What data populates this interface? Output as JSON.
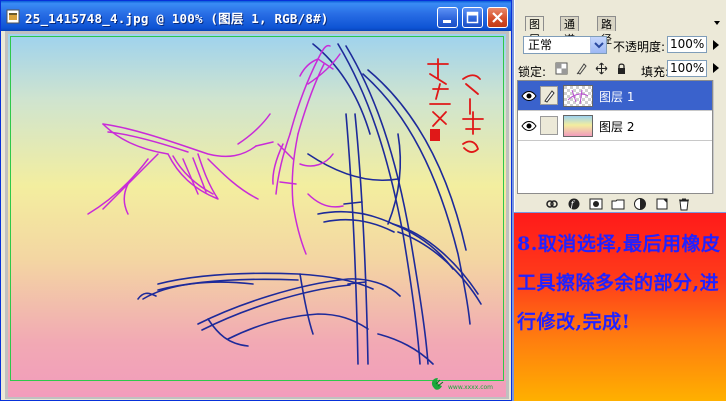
{
  "document": {
    "title": "25_1415748_4.jpg @ 100% (图层 1, RGB/8#)",
    "watermark_text": "www.xxxx.com"
  },
  "layers_panel": {
    "tabs": [
      {
        "label": "图层",
        "active": true
      },
      {
        "label": "通道",
        "active": false
      },
      {
        "label": "路径",
        "active": false
      }
    ],
    "blend_mode": "正常",
    "opacity_label": "不透明度:",
    "opacity_value": "100%",
    "lock_label": "锁定:",
    "fill_label": "填充:",
    "fill_value": "100%",
    "layers": [
      {
        "name": "图层 1",
        "selected": true,
        "visible": true
      },
      {
        "name": "图层 2",
        "selected": false,
        "visible": true
      }
    ],
    "footer_icons": [
      "link-layers-icon",
      "layer-style-icon",
      "layer-mask-icon",
      "new-group-icon",
      "adjustment-layer-icon",
      "new-layer-icon",
      "delete-layer-icon"
    ]
  },
  "instruction": {
    "text": "8.取消选择,最后用橡皮工具擦除多余的部分,进行修改,完成!"
  },
  "colors": {
    "titlebar_blue": "#2a6fe6",
    "selected_layer": "#3a62cc",
    "instruction_text": "#2222ff",
    "drawing_magenta": "#c92bd8",
    "drawing_navy": "#1d2a9a",
    "seal_red": "#e01818"
  }
}
